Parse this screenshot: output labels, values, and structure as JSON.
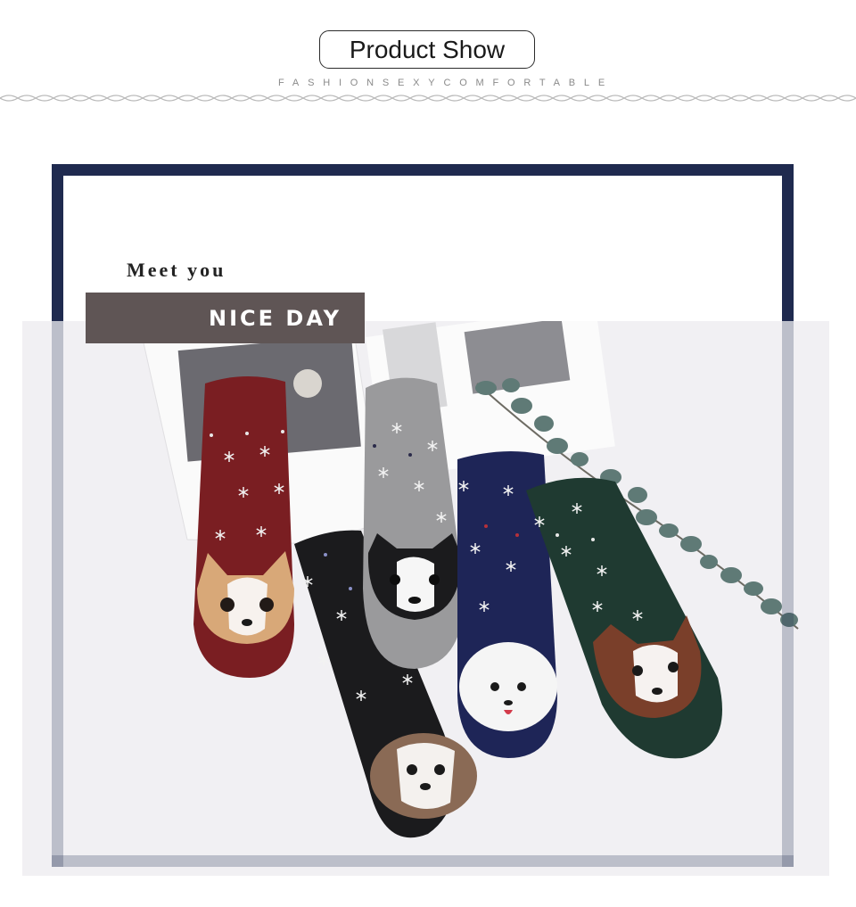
{
  "header": {
    "title": "Product Show",
    "subtitle": "FASHIONSEXYCOMFORTABLE"
  },
  "banner": {
    "meet_text": "Meet you",
    "nice_day_text": "NICE DAY"
  },
  "product_photo": {
    "sock_colors": [
      "#7a1e22",
      "#1b1b1d",
      "#9a9a9c",
      "#1e2557",
      "#1f3a31"
    ],
    "dog_icons": [
      "corgi-icon",
      "beagle-icon",
      "french-bulldog-icon",
      "maltese-icon",
      "chihuahua-icon"
    ]
  },
  "colors": {
    "frame": "#1f2a4f",
    "nice_day_bg": "#5f5555",
    "wave": "#b9b9b9"
  }
}
